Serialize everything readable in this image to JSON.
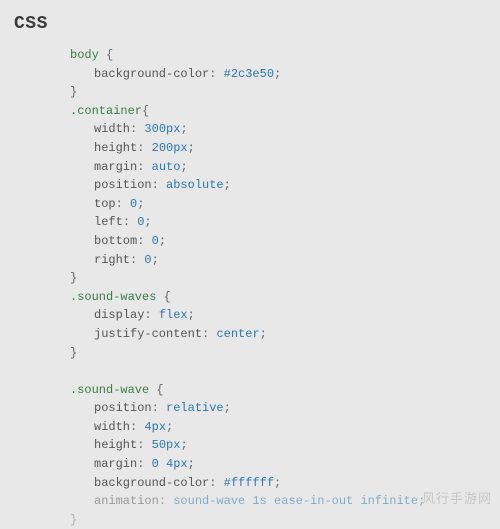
{
  "title": "CSS",
  "code": {
    "body_sel": "body",
    "body_open": " {",
    "body_bg_prop": "background-color",
    "body_bg_val": "#2c3e50",
    "close": "}",
    "container_sel": ".container",
    "container_open": "{",
    "width_prop": "width",
    "width_val": "300px",
    "height_prop": "height",
    "height_val": "200px",
    "margin_prop": "margin",
    "margin_val": "auto",
    "position_prop": "position",
    "position_val": "absolute",
    "top_prop": "top",
    "top_val": "0",
    "left_prop": "left",
    "left_val": "0",
    "bottom_prop": "bottom",
    "bottom_val": "0",
    "right_prop": "right",
    "right_val": "0",
    "sw_plural_sel": ".sound-waves",
    "sw_open": " {",
    "display_prop": "display",
    "display_val": "flex",
    "jc_prop": "justify-content",
    "jc_val": "center",
    "sw_sing_sel": ".sound-wave",
    "position2_prop": "position",
    "position2_val": "relative",
    "width2_prop": "width",
    "width2_val": "4px",
    "height2_prop": "height",
    "height2_val": "50px",
    "margin2_prop": "margin",
    "margin2_val": "0 4px",
    "bg2_prop": "background-color",
    "bg2_val": "#ffffff",
    "anim_prop": "animation",
    "anim_val": "sound-wave 1s ease-in-out infinite"
  },
  "watermark": "风行手游网"
}
